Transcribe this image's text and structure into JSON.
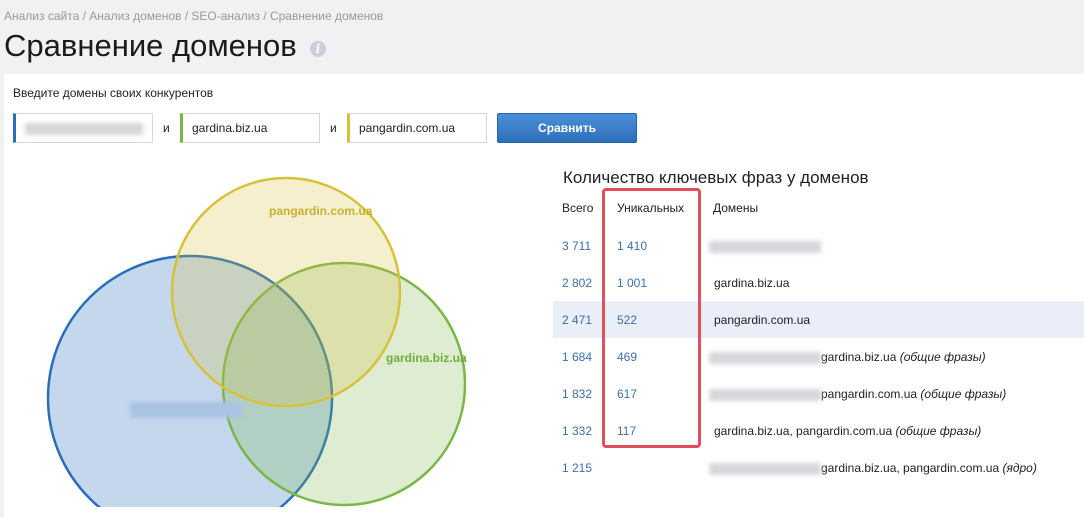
{
  "breadcrumb": {
    "items": [
      "Анализ сайта",
      "Анализ доменов",
      "SEO-анализ",
      "Сравнение доменов"
    ],
    "separator": " / "
  },
  "page": {
    "title": "Сравнение доменов",
    "info_icon": "i"
  },
  "form": {
    "label": "Введите домены своих конкурентов",
    "domain1": "",
    "domain2": "gardina.biz.ua",
    "domain3": "pangardin.com.ua",
    "and_label": "и",
    "submit_label": "Сравнить"
  },
  "venn": {
    "label_yellow": "pangardin.com.ua",
    "label_green": "gardina.biz.ua",
    "colors": {
      "blue": "#2a6ebb",
      "green": "#7ab648",
      "yellow": "#d8c13a"
    }
  },
  "table": {
    "title": "Количество ключевых фраз у доменов",
    "columns": {
      "total": "Всего",
      "unique": "Уникальных",
      "domains": "Домены"
    },
    "rows": [
      {
        "total": "3 711",
        "unique": "1 410",
        "domains": "",
        "note": ""
      },
      {
        "total": "2 802",
        "unique": "1 001",
        "domains": "gardina.biz.ua",
        "note": ""
      },
      {
        "total": "2 471",
        "unique": "522",
        "domains": "pangardin.com.ua",
        "note": ""
      },
      {
        "total": "1 684",
        "unique": "469",
        "domains": "gardina.biz.ua",
        "note": "(общие фразы)"
      },
      {
        "total": "1 832",
        "unique": "617",
        "domains": "pangardin.com.ua",
        "note": "(общие фразы)"
      },
      {
        "total": "1 332",
        "unique": "117",
        "domains": "gardina.biz.ua, pangardin.com.ua",
        "note": "(общие фразы)"
      },
      {
        "total": "1 215",
        "unique": "",
        "domains": "gardina.biz.ua, pangardin.com.ua",
        "note": "(ядро)"
      }
    ]
  }
}
